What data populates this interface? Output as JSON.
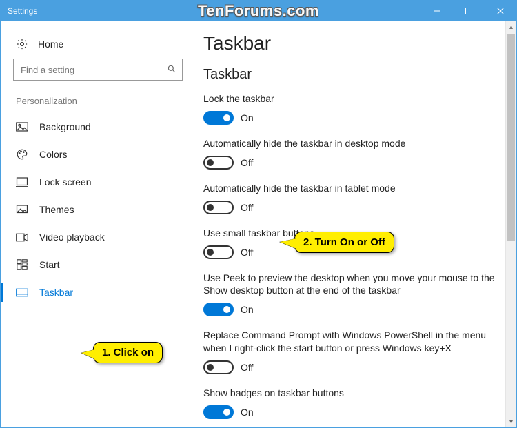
{
  "window": {
    "title": "Settings"
  },
  "watermark": "TenForums.com",
  "sidebar": {
    "home": "Home",
    "search_placeholder": "Find a setting",
    "category": "Personalization",
    "items": [
      {
        "label": "Background",
        "active": false
      },
      {
        "label": "Colors",
        "active": false
      },
      {
        "label": "Lock screen",
        "active": false
      },
      {
        "label": "Themes",
        "active": false
      },
      {
        "label": "Video playback",
        "active": false
      },
      {
        "label": "Start",
        "active": false
      },
      {
        "label": "Taskbar",
        "active": true
      }
    ]
  },
  "page": {
    "title": "Taskbar",
    "section": "Taskbar",
    "on_label": "On",
    "off_label": "Off",
    "settings": [
      {
        "label": "Lock the taskbar",
        "state": "on"
      },
      {
        "label": "Automatically hide the taskbar in desktop mode",
        "state": "off"
      },
      {
        "label": "Automatically hide the taskbar in tablet mode",
        "state": "off"
      },
      {
        "label": "Use small taskbar buttons",
        "state": "off"
      },
      {
        "label": "Use Peek to preview the desktop when you move your mouse to the Show desktop button at the end of the taskbar",
        "state": "on"
      },
      {
        "label": "Replace Command Prompt with Windows PowerShell in the menu when I right-click the start button or press Windows key+X",
        "state": "off"
      },
      {
        "label": "Show badges on taskbar buttons",
        "state": "on"
      }
    ]
  },
  "callouts": {
    "c1": "1. Click on",
    "c2": "2. Turn On or Off"
  }
}
